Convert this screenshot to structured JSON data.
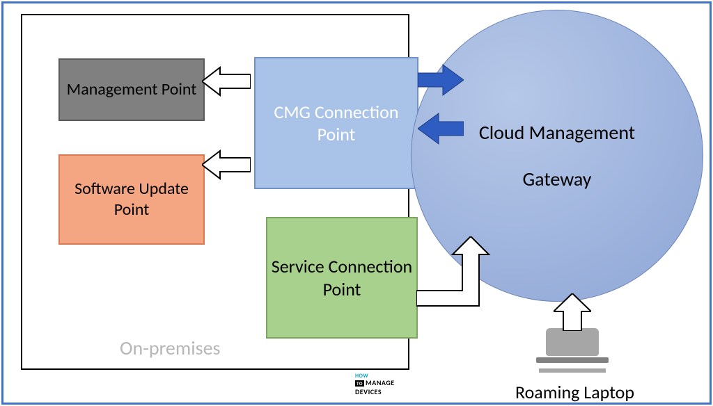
{
  "diagram": {
    "on_premises_label": "On-premises",
    "nodes": {
      "management_point": "Management Point",
      "software_update_point": "Software Update Point",
      "cmg_connection_point": "CMG Connection Point",
      "service_connection_point": "Service Connection Point",
      "cloud_management_gateway_line1": "Cloud Management",
      "cloud_management_gateway_line2": "Gateway"
    },
    "roaming_laptop_label": "Roaming Laptop",
    "arrows": {
      "cmg_to_management": {
        "direction": "left",
        "style": "outline"
      },
      "cmg_to_software_update": {
        "direction": "left",
        "style": "outline"
      },
      "cmg_to_cloud_right": {
        "direction": "right",
        "style": "filled",
        "color": "#2f5cc0"
      },
      "cloud_to_cmg_left": {
        "direction": "left",
        "style": "filled",
        "color": "#2f5cc0"
      },
      "service_to_cloud": {
        "direction": "up-right-bent",
        "style": "outline"
      },
      "laptop_to_cloud": {
        "direction": "up",
        "style": "outline"
      }
    },
    "watermark": {
      "line1": "HOW",
      "line2_prefix": "TO",
      "line2_text": "MANAGE",
      "line3": "DEVICES"
    }
  }
}
